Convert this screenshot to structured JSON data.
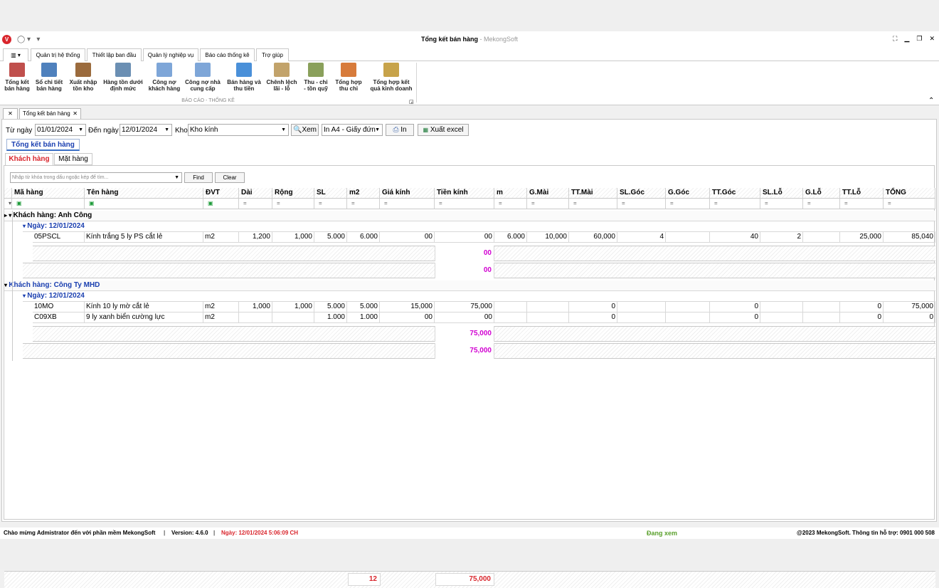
{
  "window": {
    "title": "Tổng kết bán hàng",
    "brand": "- MekongSoft"
  },
  "menu_tabs": [
    "Quản trị hệ thống",
    "Thiết lập ban đầu",
    "Quản lý nghiệp vụ",
    "Báo cáo thống kê",
    "Trợ giúp"
  ],
  "ribbon": {
    "buttons": [
      {
        "l1": "Tổng kết",
        "l2": "bán hàng",
        "icon": "sales-summary-icon",
        "color": "#c0504d"
      },
      {
        "l1": "Sổ chi tiết",
        "l2": "bán hàng",
        "icon": "ledger-icon",
        "color": "#4f81bd"
      },
      {
        "l1": "Xuất nhập",
        "l2": "tồn kho",
        "icon": "warehouse-icon",
        "color": "#9b6b3d"
      },
      {
        "l1": "Hàng tồn dưới",
        "l2": "định mức",
        "icon": "database-icon",
        "color": "#6b8fb3"
      },
      {
        "l1": "Công nợ",
        "l2": "khách hàng",
        "icon": "customer-debt-icon",
        "color": "#7ea6d8"
      },
      {
        "l1": "Công nợ nhà",
        "l2": "cung cấp",
        "icon": "supplier-debt-icon",
        "color": "#7ea6d8"
      },
      {
        "l1": "Bán hàng và",
        "l2": "thu tiền",
        "icon": "sales-collection-icon",
        "color": "#4a90d9"
      },
      {
        "l1": "Chênh lệch",
        "l2": "lãi - lỗ",
        "icon": "profit-loss-icon",
        "color": "#c2a36b"
      },
      {
        "l1": "Thu - chi",
        "l2": "- tồn quỹ",
        "icon": "cash-fund-icon",
        "color": "#8aa05b"
      },
      {
        "l1": "Tổng hợp",
        "l2": "thu chi",
        "icon": "income-expense-icon",
        "color": "#d77b3b"
      },
      {
        "l1": "Tổng hợp kết",
        "l2": "quả kinh doanh",
        "icon": "business-result-icon",
        "color": "#c7a34a"
      }
    ],
    "group_label": "BÁO CÁO - THỐNG KÊ"
  },
  "doc_tab": "Tổng kết bán hàng",
  "filters": {
    "from_label": "Từ ngày",
    "from_value": "01/01/2024",
    "to_label": "Đến ngày",
    "to_value": "12/01/2024",
    "kho_label": "Kho",
    "kho_value": "Kho kính",
    "view_button": "Xem",
    "print_format": "In A4 - Giấy đứn",
    "print_button": "In",
    "excel_button": "Xuất excel"
  },
  "group_tab": "Tổng kết bán hàng",
  "sub_tabs": [
    "Khách hàng",
    "Mặt hàng"
  ],
  "search": {
    "placeholder": "Nhập từ khóa trong dấu ngoặc kép để tìm...",
    "find": "Find",
    "clear": "Clear"
  },
  "columns": [
    "Mã hàng",
    "Tên hàng",
    "ĐVT",
    "Dài",
    "Rộng",
    "SL",
    "m2",
    "Giá kính",
    "Tiền kính",
    "m",
    "G.Mài",
    "TT.Mài",
    "SL.Góc",
    "G.Góc",
    "TT.Góc",
    "SL.Lỗ",
    "G.Lỗ",
    "TT.Lỗ",
    "TỔNG"
  ],
  "groups": [
    {
      "customer": "Khách hàng: Anh Công",
      "date": "Ngày: 12/01/2024",
      "rows": [
        [
          "05PSCL",
          "Kính trắng 5 ly PS cắt lẻ",
          "m2",
          "1,200",
          "1,000",
          "5.000",
          "6.000",
          "00",
          "00",
          "6.000",
          "10,000",
          "60,000",
          "4",
          "",
          "40",
          "2",
          "",
          "25,000",
          "85,040"
        ]
      ],
      "date_total": "00",
      "customer_total": "00"
    },
    {
      "customer": "Khách hàng: Công Ty MHD",
      "date": "Ngày: 12/01/2024",
      "rows": [
        [
          "10MO",
          "Kính 10 ly mờ cắt lẻ",
          "m2",
          "1,000",
          "1,000",
          "5.000",
          "5.000",
          "15,000",
          "75,000",
          "",
          "",
          "0",
          "",
          "",
          "0",
          "",
          "",
          "0",
          "75,000"
        ],
        [
          "C09XB",
          "9 ly xanh biển cường lực",
          "m2",
          "",
          "",
          "1.000",
          "1.000",
          "00",
          "00",
          "",
          "",
          "0",
          "",
          "",
          "0",
          "",
          "",
          "0",
          "0"
        ]
      ],
      "date_total": "75,000",
      "customer_total": "75,000"
    }
  ],
  "footer": {
    "sl_total": "12",
    "tien_total": "75,000"
  },
  "status": {
    "welcome": "Chào mừng Admistrator đến với phần mềm MekongSoft",
    "version": "Version: 4.6.0",
    "date": "Ngày: 12/01/2024 5:06:09 CH",
    "state": "Đang xem",
    "copyright": "@2023 MekongSoft. Thông tin hỗ trợ: 0901 000 508"
  }
}
